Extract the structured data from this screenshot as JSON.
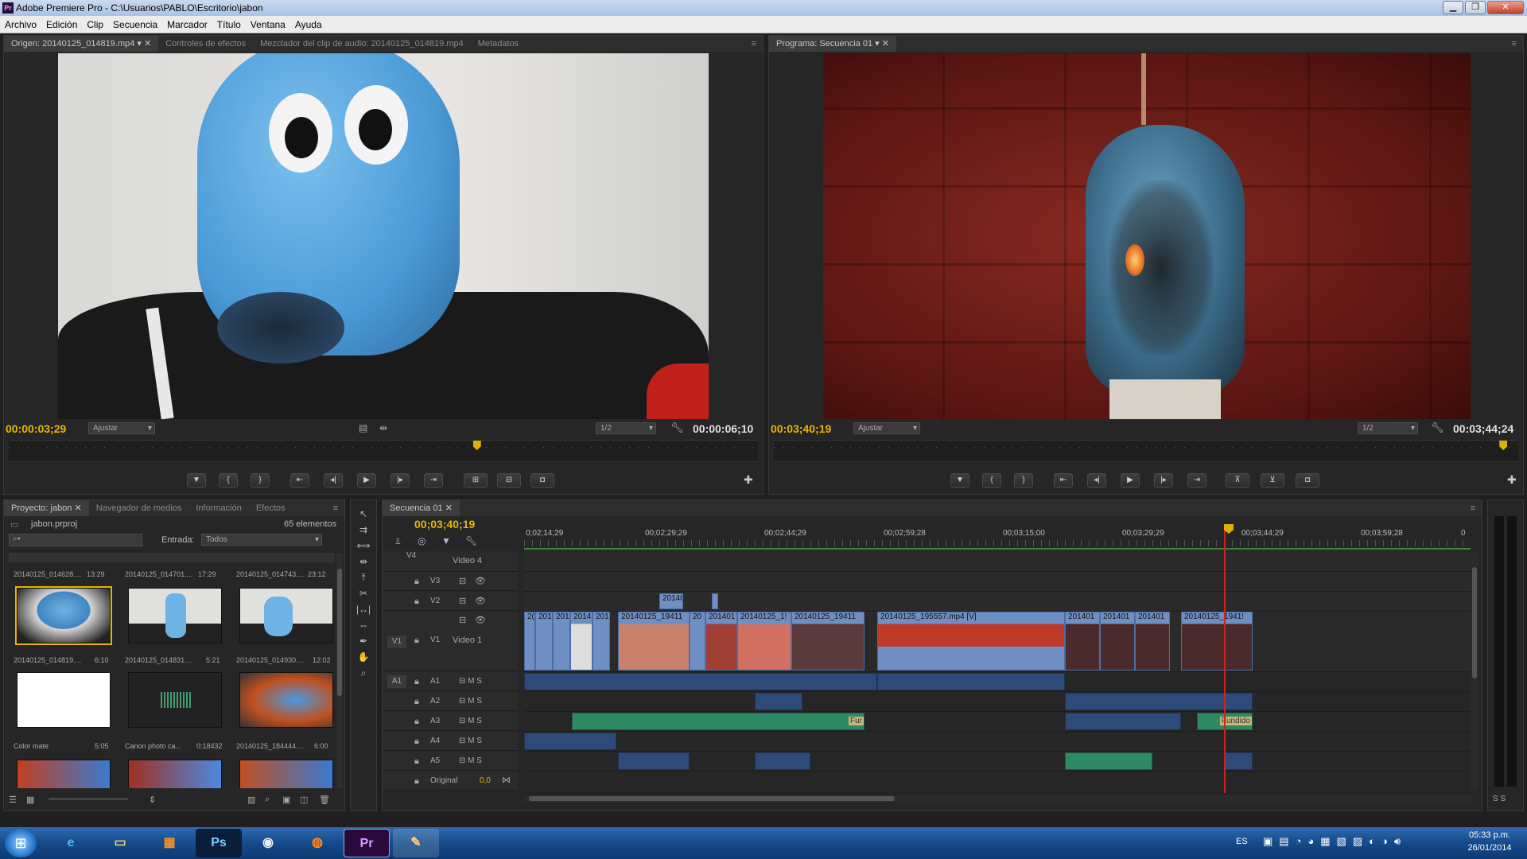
{
  "window": {
    "title": "Adobe Premiere Pro - C:\\Usuarios\\PABLO\\Escritorio\\jabon"
  },
  "menu": [
    "Archivo",
    "Edición",
    "Clip",
    "Secuencia",
    "Marcador",
    "Título",
    "Ventana",
    "Ayuda"
  ],
  "source_monitor": {
    "tabs": [
      "Origen: 20140125_014819.mp4",
      "Controles de efectos",
      "Mezclador del clip de audio: 20140125_014819.mp4",
      "Metadatos"
    ],
    "timecode_current": "00:00:03;29",
    "fit": "Ajustar",
    "resolution": "1/2",
    "timecode_duration": "00:00:06;10",
    "playhead_fraction": 0.625
  },
  "program_monitor": {
    "tabs": [
      "Programa: Secuencia 01"
    ],
    "timecode_current": "00:03;40;19",
    "fit": "Ajustar",
    "resolution": "1/2",
    "timecode_duration": "00:03;44;24",
    "playhead_fraction": 0.98
  },
  "project_panel": {
    "tabs": [
      "Proyecto: jabon",
      "Navegador de medios",
      "Información",
      "Efectos"
    ],
    "file": "jabon.prproj",
    "count": "65 elementos",
    "input_label": "Entrada:",
    "input_value": "Todos",
    "items": [
      {
        "name": "20140125_014628....",
        "dur": "13:29"
      },
      {
        "name": "20140125_014701....",
        "dur": "17:29"
      },
      {
        "name": "20140125_014743....",
        "dur": "23:12"
      },
      {
        "name": "20140125_014819....",
        "dur": "6:10"
      },
      {
        "name": "20140125_014831....",
        "dur": "5:21"
      },
      {
        "name": "20140125_014930....",
        "dur": "12:02"
      },
      {
        "name": "Color mate",
        "dur": "5:05"
      },
      {
        "name": "Canon photo ca...",
        "dur": "0:18432"
      },
      {
        "name": "20140125_184444....",
        "dur": "6:00"
      }
    ]
  },
  "timeline": {
    "tab": "Secuencia 01",
    "timecode": "00;03;40;19",
    "ruler": [
      "0;02;14;29",
      "00;02;29;29",
      "00;02;44;29",
      "00;02;59;28",
      "00;03;15;00",
      "00;03;29;29",
      "00;03;44;29",
      "00;03;59;28",
      "0"
    ],
    "video_tracks": [
      {
        "id": "V4",
        "name": "Video 4"
      },
      {
        "id": "V3",
        "name": ""
      },
      {
        "id": "V2",
        "name": ""
      },
      {
        "id": "V1",
        "name": "Video 1"
      }
    ],
    "audio_tracks": [
      "A1",
      "A2",
      "A3",
      "A4",
      "A5"
    ],
    "master": {
      "label": "Original",
      "value": "0,0"
    },
    "v2_clip": "20140",
    "v1_clips": [
      "2(",
      "201",
      "201",
      "2014",
      "201",
      "20140125_19411",
      "20",
      "201401",
      "20140125_1!",
      "20140125_19411",
      "20140125_195557.mp4 [V]",
      "201401",
      "201401",
      "201401",
      "20140125_1941!"
    ],
    "a3_label": "Fur",
    "a3_label2": "Fundido"
  },
  "tools": [
    "selection",
    "track-select",
    "ripple",
    "rolling",
    "rate",
    "razor",
    "slip",
    "slide",
    "pen",
    "hand",
    "zoom"
  ],
  "taskbar": {
    "lang": "ES",
    "time": "05:33 p.m.",
    "date": "26/01/2014",
    "apps": [
      "start",
      "internet-explorer",
      "explorer",
      "control-panel",
      "photoshop",
      "unknown-app",
      "firefox",
      "premiere",
      "paint"
    ],
    "ps_label": "Ps",
    "pr_label": "Pr"
  }
}
